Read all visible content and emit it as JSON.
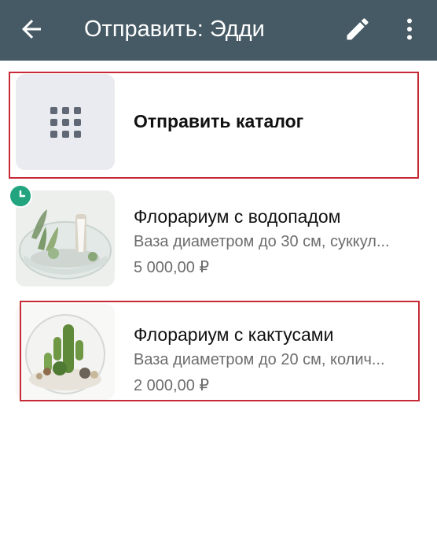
{
  "appbar": {
    "title": "Отправить: Эдди",
    "background": "#455a64",
    "icons": [
      "arrow-back-icon",
      "edit-pencil-icon",
      "more-vert-icon"
    ]
  },
  "catalog": {
    "label": "Отправить каталог",
    "icon": "grid-icon"
  },
  "products": [
    {
      "title": "Флорариум с водопадом",
      "description": "Ваза диаметром до 30 см, суккул...",
      "price": "5 000,00 ₽",
      "status_icon": "clock-icon"
    },
    {
      "title": "Флорариум с кактусами",
      "description": "Ваза диаметром до 20 см, колич...",
      "price": "2 000,00 ₽"
    }
  ],
  "colors": {
    "highlight": "#c62a36",
    "badge": "#22a57f"
  }
}
